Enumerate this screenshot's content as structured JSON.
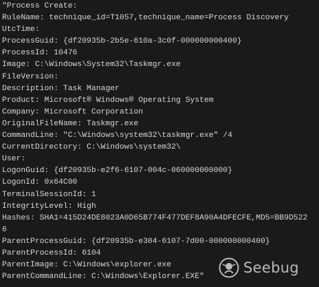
{
  "log": {
    "lines": [
      "\"Process Create:",
      "RuleName: technique_id=T1057,technique_name=Process Discovery",
      "UtcTime:",
      "ProcessGuid: {df20935b-2b5e-610a-3c0f-000000000400}",
      "ProcessId: 10476",
      "Image: C:\\Windows\\System32\\Taskmgr.exe",
      "FileVersion:",
      "Description: Task Manager",
      "Product: Microsoft® Windows® Operating System",
      "Company: Microsoft Corporation",
      "OriginalFileName: Taskmgr.exe",
      "CommandLine: \"C:\\Windows\\system32\\taskmgr.exe\" /4",
      "CurrentDirectory: C:\\Windows\\system32\\",
      "User:",
      "LogonGuid: {df20935b-e2f6-6107-004c-060000000000}",
      "LogonId: 0x64C00",
      "TerminalSessionId: 1",
      "IntegrityLevel: High",
      "Hashes: SHA1=415D24DE8023A0D65B774F477DEF8A90A4DFECFE,MD5=BB9D522",
      "6",
      "ParentProcessGuid: {df20935b-e304-6107-7d00-000000000400}",
      "ParentProcessId: 6104",
      "ParentImage: C:\\Windows\\explorer.exe",
      "ParentCommandLine: C:\\Windows\\Explorer.EXE\""
    ]
  },
  "watermark": {
    "brand": "Seebug",
    "icon": "seebug-logo-icon",
    "color": "#e6e6e6"
  },
  "theme": {
    "background": "#1a1a1a",
    "text": "#d8d8d8"
  }
}
